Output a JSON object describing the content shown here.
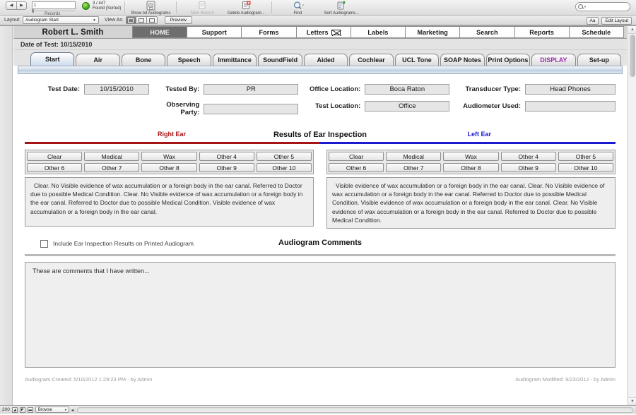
{
  "toolbar": {
    "prev_label": "◀",
    "next_label": "▶",
    "record_number": "1",
    "records_label": "Records",
    "found_count": "3 / 447",
    "found_status": "Found (Sorted)",
    "buttons": [
      {
        "label": "Show All Audiograms",
        "icon": "show-all-records-icon",
        "enabled": true
      },
      {
        "label": "New Record",
        "icon": "new-record-icon",
        "enabled": false
      },
      {
        "label": "Delete Audiogram...",
        "icon": "delete-record-icon",
        "enabled": true
      },
      {
        "label": "Find",
        "icon": "find-icon",
        "enabled": true
      },
      {
        "label": "Sort Audiograms...",
        "icon": "sort-icon",
        "enabled": true
      }
    ],
    "search_placeholder": ""
  },
  "layoutbar": {
    "layout_label": "Layout:",
    "layout_value": "Audiogram Start",
    "view_as_label": "View As:",
    "preview_label": "Preview",
    "aa_label": "Aa",
    "edit_layout_label": "Edit Layout"
  },
  "header": {
    "patient_name": "Robert L. Smith",
    "main_tabs": [
      {
        "label": "HOME",
        "active": true
      },
      {
        "label": "Support",
        "active": false
      },
      {
        "label": "Forms",
        "active": false
      },
      {
        "label": "Letters",
        "active": false,
        "icon": "envelope-icon"
      },
      {
        "label": "Labels",
        "active": false
      },
      {
        "label": "Marketing",
        "active": false
      },
      {
        "label": "Search",
        "active": false
      },
      {
        "label": "Reports",
        "active": false
      },
      {
        "label": "Schedule",
        "active": false
      }
    ],
    "date_of_test": "Date of Test: 10/15/2010"
  },
  "subtabs": [
    {
      "label": "Start",
      "active": true,
      "style": "normal"
    },
    {
      "label": "Air",
      "active": false,
      "style": "normal"
    },
    {
      "label": "Bone",
      "active": false,
      "style": "normal"
    },
    {
      "label": "Speech",
      "active": false,
      "style": "normal"
    },
    {
      "label": "Immittance",
      "active": false,
      "style": "normal"
    },
    {
      "label": "SoundField",
      "active": false,
      "style": "normal"
    },
    {
      "label": "Aided",
      "active": false,
      "style": "normal"
    },
    {
      "label": "Cochlear",
      "active": false,
      "style": "normal"
    },
    {
      "label": "UCL Tone",
      "active": false,
      "style": "normal"
    },
    {
      "label": "SOAP Notes",
      "active": false,
      "style": "normal"
    },
    {
      "label": "Print Options",
      "active": false,
      "style": "normal"
    },
    {
      "label": "DISPLAY",
      "active": false,
      "style": "display"
    },
    {
      "label": "Set-up",
      "active": false,
      "style": "normal"
    }
  ],
  "form": {
    "fields": [
      {
        "label": "Test Date:",
        "value": "10/15/2010"
      },
      {
        "label": "Tested By:",
        "value": "PR"
      },
      {
        "label": "Observing Party:",
        "value": ""
      },
      {
        "label": "Office Location:",
        "value": "Boca Raton"
      },
      {
        "label": "Test Location:",
        "value": "Office"
      },
      {
        "label": "Transducer Type:",
        "value": "Head Phones"
      },
      {
        "label": "Audiometer Used:",
        "value": ""
      }
    ]
  },
  "inspection": {
    "section_title": "Results of Ear Inspection",
    "right_label": "Right Ear",
    "left_label": "Left Ear",
    "right_color": "#a51414",
    "left_color": "#1a1ad0",
    "buttons_row1": [
      "Clear",
      "Medical",
      "Wax",
      "Other 4",
      "Other 5"
    ],
    "buttons_row2": [
      "Other 6",
      "Other 7",
      "Other 8",
      "Other 9",
      "Other 10"
    ],
    "right_text": "Clear. No Visible evidence of wax accumulation or a foreign body in the ear canal.  Referred to Doctor due to possible Medical Condition.   Clear. No Visible evidence of wax accumulation or a foreign body in the ear canal.  Referred to Doctor due to possible Medical Condition.  Visible evidence of wax accumulation or a foreign body in the ear canal.",
    "left_text": "Visible evidence of wax accumulation or a foreign body in the ear canal.  Clear. No Visible evidence of wax accumulation or a foreign body in the ear canal.  Referred to Doctor due to possible Medical Condition.  Visible evidence of wax accumulation or a foreign body in the ear canal.  Clear. No Visible evidence of wax accumulation or a foreign body in the ear canal.  Referred to Doctor due to possible Medical Condition."
  },
  "comments": {
    "checkbox_label": "Include Ear Inspection Results on Printed Audiogram",
    "checkbox_checked": false,
    "title": "Audiogram Comments",
    "text": "These are comments that I have written..."
  },
  "footer": {
    "created": "Audiogram Created: 5/10/2012 1:29:23 PM   -   by Admin",
    "modified": "Audiogram Modified: 9/23/2012   -   by Admin"
  },
  "statusbar": {
    "zoom_level": "200",
    "mode": "Browse"
  }
}
